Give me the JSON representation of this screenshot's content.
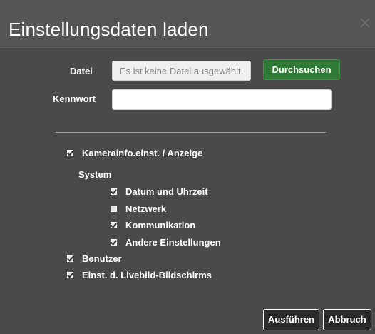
{
  "dialog": {
    "title": "Einstellungsdaten laden",
    "close_icon": "close-icon"
  },
  "form": {
    "file_label": "Datei",
    "file_value": "Es ist keine Datei ausgewählt.",
    "browse_label": "Durchsuchen",
    "password_label": "Kennwort",
    "password_value": ""
  },
  "options": {
    "camera_info": {
      "label": "Kamerainfo.einst. / Anzeige",
      "checked": true
    },
    "system_section": "System",
    "date_time": {
      "label": "Datum und Uhrzeit",
      "checked": true
    },
    "network": {
      "label": "Netzwerk",
      "checked": false
    },
    "communication": {
      "label": "Kommunikation",
      "checked": true
    },
    "other_settings": {
      "label": "Andere Einstellungen",
      "checked": true
    },
    "user": {
      "label": "Benutzer",
      "checked": true
    },
    "liveview": {
      "label": "Einst. d. Livebild-Bildschirms",
      "checked": true
    }
  },
  "footer": {
    "execute_label": "Ausführen",
    "cancel_label": "Abbruch"
  },
  "colors": {
    "background": "#4a4a4a",
    "header": "#555555",
    "browse_button": "#2f7a36",
    "action_button": "#2a2a2a"
  }
}
